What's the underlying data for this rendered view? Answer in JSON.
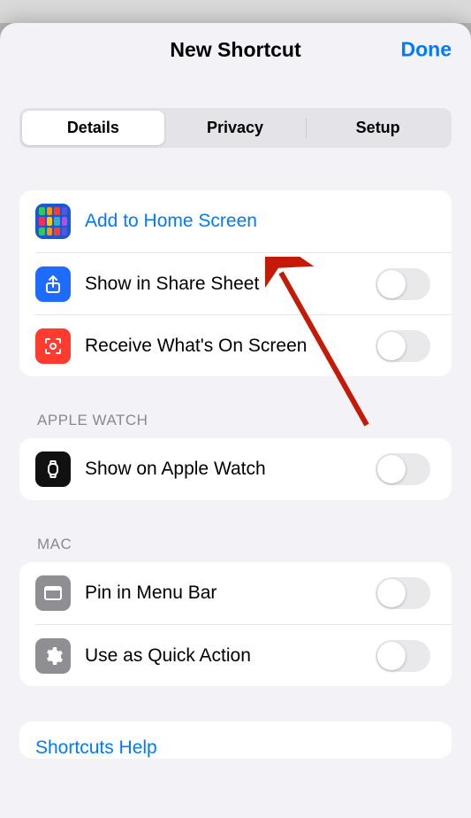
{
  "nav": {
    "title": "New Shortcut",
    "done": "Done"
  },
  "segments": {
    "details": "Details",
    "privacy": "Privacy",
    "setup": "Setup"
  },
  "rows": {
    "addHome": "Add to Home Screen",
    "shareSheet": "Show in Share Sheet",
    "receiveScreen": "Receive What's On Screen",
    "appleWatch": "Show on Apple Watch",
    "pinMenuBar": "Pin in Menu Bar",
    "quickAction": "Use as Quick Action"
  },
  "sections": {
    "appleWatch": "APPLE WATCH",
    "mac": "MAC"
  },
  "help": "Shortcuts Help",
  "colors": {
    "accent": "#007aff",
    "homeIconCells": [
      "#34c759",
      "#ff9500",
      "#ff3b30",
      "#5856d6",
      "#ff2d55",
      "#ffcc00",
      "#30b0c7",
      "#af52de",
      "#34c759",
      "#ff9500",
      "#ff3b30",
      "#5856d6"
    ]
  },
  "toggles": {
    "shareSheet": false,
    "receiveScreen": false,
    "appleWatch": false,
    "pinMenuBar": false,
    "quickAction": false
  }
}
